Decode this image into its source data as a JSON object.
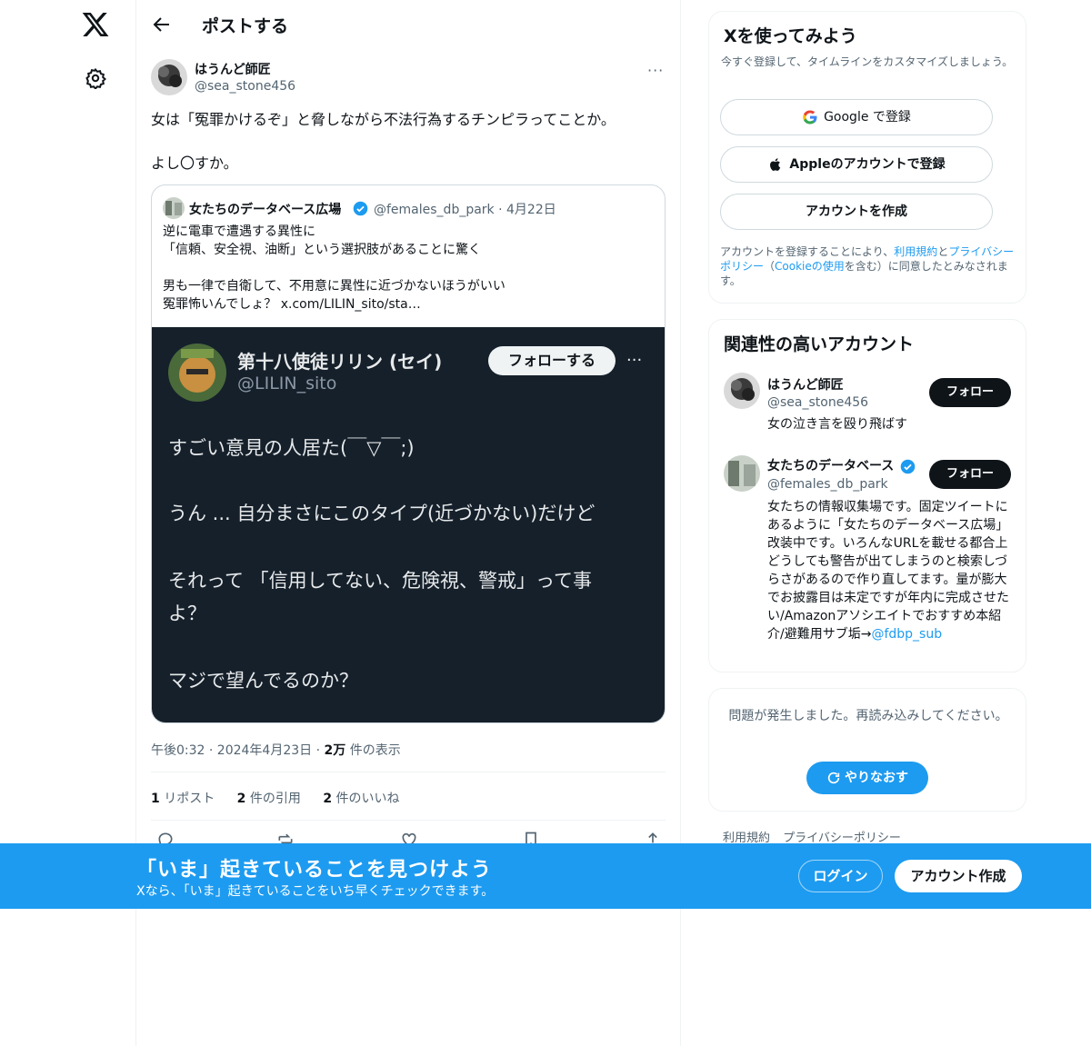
{
  "colors": {
    "accent": "#1d9bf0",
    "text": "#0f1419",
    "secondary": "#536471",
    "dark_image_bg": "#15202b"
  },
  "icons": {
    "logo": "x-logo-icon",
    "settings": "gear-icon",
    "back": "arrow-left-icon",
    "verified": "verified-badge-icon"
  },
  "header": {
    "title": "ポストする"
  },
  "tweet": {
    "author_name": "はうんど師匠",
    "author_handle": "@sea_stone456",
    "more": "···",
    "text": "女は「冤罪かけるぞ」と脅しながら不法行為するチンピラってことか。\n\nよし〇すか。",
    "timestamp": "午後0:32 · 2024年4月23日 · ",
    "views_num": "2万",
    "views_label": " 件の表示",
    "stats": {
      "reposts_num": "1",
      "reposts_label": " リポスト",
      "quotes_num": "2",
      "quotes_label": " 件の引用",
      "likes_num": "2",
      "likes_label": " 件のいいね"
    }
  },
  "quote": {
    "author_name": "女たちのデータベース広場",
    "author_handle": "@females_db_park · 4月22日",
    "text": "逆に電車で遭遇する異性に\n「信頼、安全視、油断」という選択肢があることに驚く\n\n男も一律で自衛して、不用意に異性に近づかないほうがいい\n冤罪怖いんでしょ？ x.com/LILIN_sito/sta…",
    "image": {
      "name": "第十八使徒リリン (セイ)",
      "handle": "@LILIN_sito",
      "follow_label": "フォローする",
      "more": "···",
      "line1": "すごい意見の人居た(￣▽￣;)",
      "line2": "うん ... 自分まさにこのタイプ(近づかない)だけど",
      "line3": "それって 「信用してない、危険視、警戒」って事",
      "line4": "よ？",
      "line5": "マジで望んでるのか？"
    }
  },
  "signup": {
    "title": "Xを使ってみよう",
    "subtitle": "今すぐ登録して、タイムラインをカスタマイズしましょう。",
    "google_label": "Google で登録",
    "apple_label": "Appleのアカウントで登録",
    "create_label": "アカウントを作成",
    "legal_1": "アカウントを登録することにより、",
    "legal_terms": "利用規約",
    "legal_2": "と",
    "legal_privacy": "プライバシーポリシー",
    "legal_3": "（",
    "legal_cookie": "Cookieの使用",
    "legal_4": "を含む）に同意したとみなされます。"
  },
  "related": {
    "title": "関連性の高いアカウント",
    "follow_label": "フォロー",
    "accounts": [
      {
        "name": "はうんど師匠",
        "handle": "@sea_stone456",
        "bio": "女の泣き言を殴り飛ばす"
      },
      {
        "name": "女たちのデータベース",
        "handle": "@females_db_park",
        "bio": "女たちの情報収集場です。固定ツイートにあるように「女たちのデータベース広場」改装中です。いろんなURLを載せる都合上どうしても警告が出てしまうのと検索しづらさがあるので作り直してます。量が膨大でお披露目は未定ですが年内に完成させたい/Amazonアソシエイトでおすすめ本紹介/避難用サブ垢→",
        "bio_link": "@fdbp_sub"
      }
    ]
  },
  "error": {
    "text": "問題が発生しました。再読み込みしてください。",
    "retry_label": "やりなおす"
  },
  "footer": {
    "terms": "利用規約",
    "privacy": "プライバシーポリシー"
  },
  "banner": {
    "title": "「いま」起きていることを見つけよう",
    "subtitle": "Xなら、「いま」起きていることをいち早くチェックできます。",
    "login_label": "ログイン",
    "create_label": "アカウント作成"
  }
}
